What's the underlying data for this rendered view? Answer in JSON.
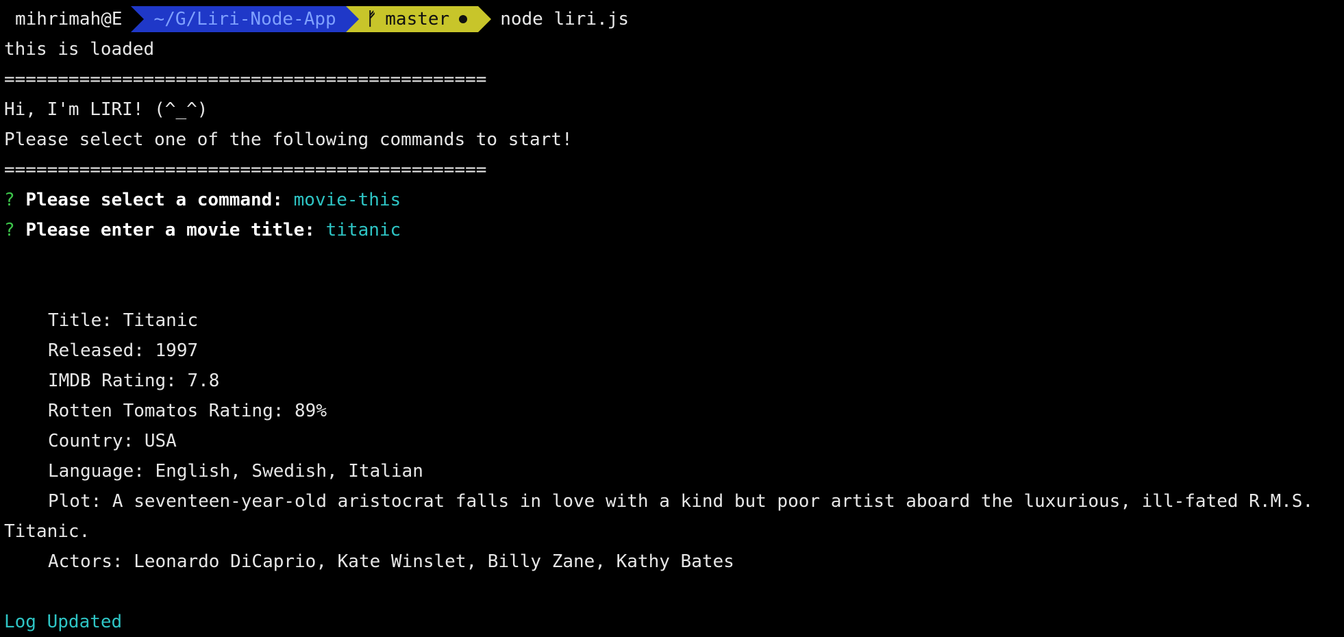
{
  "prompt": {
    "user_host": "mihrimah@E",
    "directory": "~/G/Liri-Node-App",
    "branch": "master",
    "command": "node liri.js"
  },
  "output": {
    "loaded_msg": "this is loaded",
    "separator": "=============================================",
    "greeting": "Hi, I'm LIRI! (^_^)",
    "instruction": "Please select one of the following commands to start!",
    "q1_mark": "?",
    "q1_label": "Please select a command:",
    "q1_answer": "movie-this",
    "q2_mark": "?",
    "q2_label": "Please enter a movie title:",
    "q2_answer": "titanic",
    "title": "Title: Titanic",
    "released": "Released: 1997",
    "imdb": "IMDB Rating: 7.8",
    "rotten": "Rotten Tomatos Rating: 89%",
    "country": "Country: USA",
    "language": "Language: English, Swedish, Italian",
    "plot_line1": "Plot: A seventeen-year-old aristocrat falls in love with a kind but poor artist aboard the luxurious, ill-fated R.M.S.",
    "plot_line2": "Titanic.",
    "actors": "Actors: Leonardo DiCaprio, Kate Winslet, Billy Zane, Kathy Bates",
    "log_status": "Log Updated"
  },
  "colors": {
    "background": "#000000",
    "text": "#e6e6e6",
    "prompt_dir_bg": "#1f38c8",
    "prompt_git_bg": "#c8c52a",
    "question_mark": "#3cc44a",
    "answer": "#2ec4c4"
  },
  "icons": {
    "branch": "git-branch-icon",
    "dirty": "dirty-dot-icon"
  }
}
